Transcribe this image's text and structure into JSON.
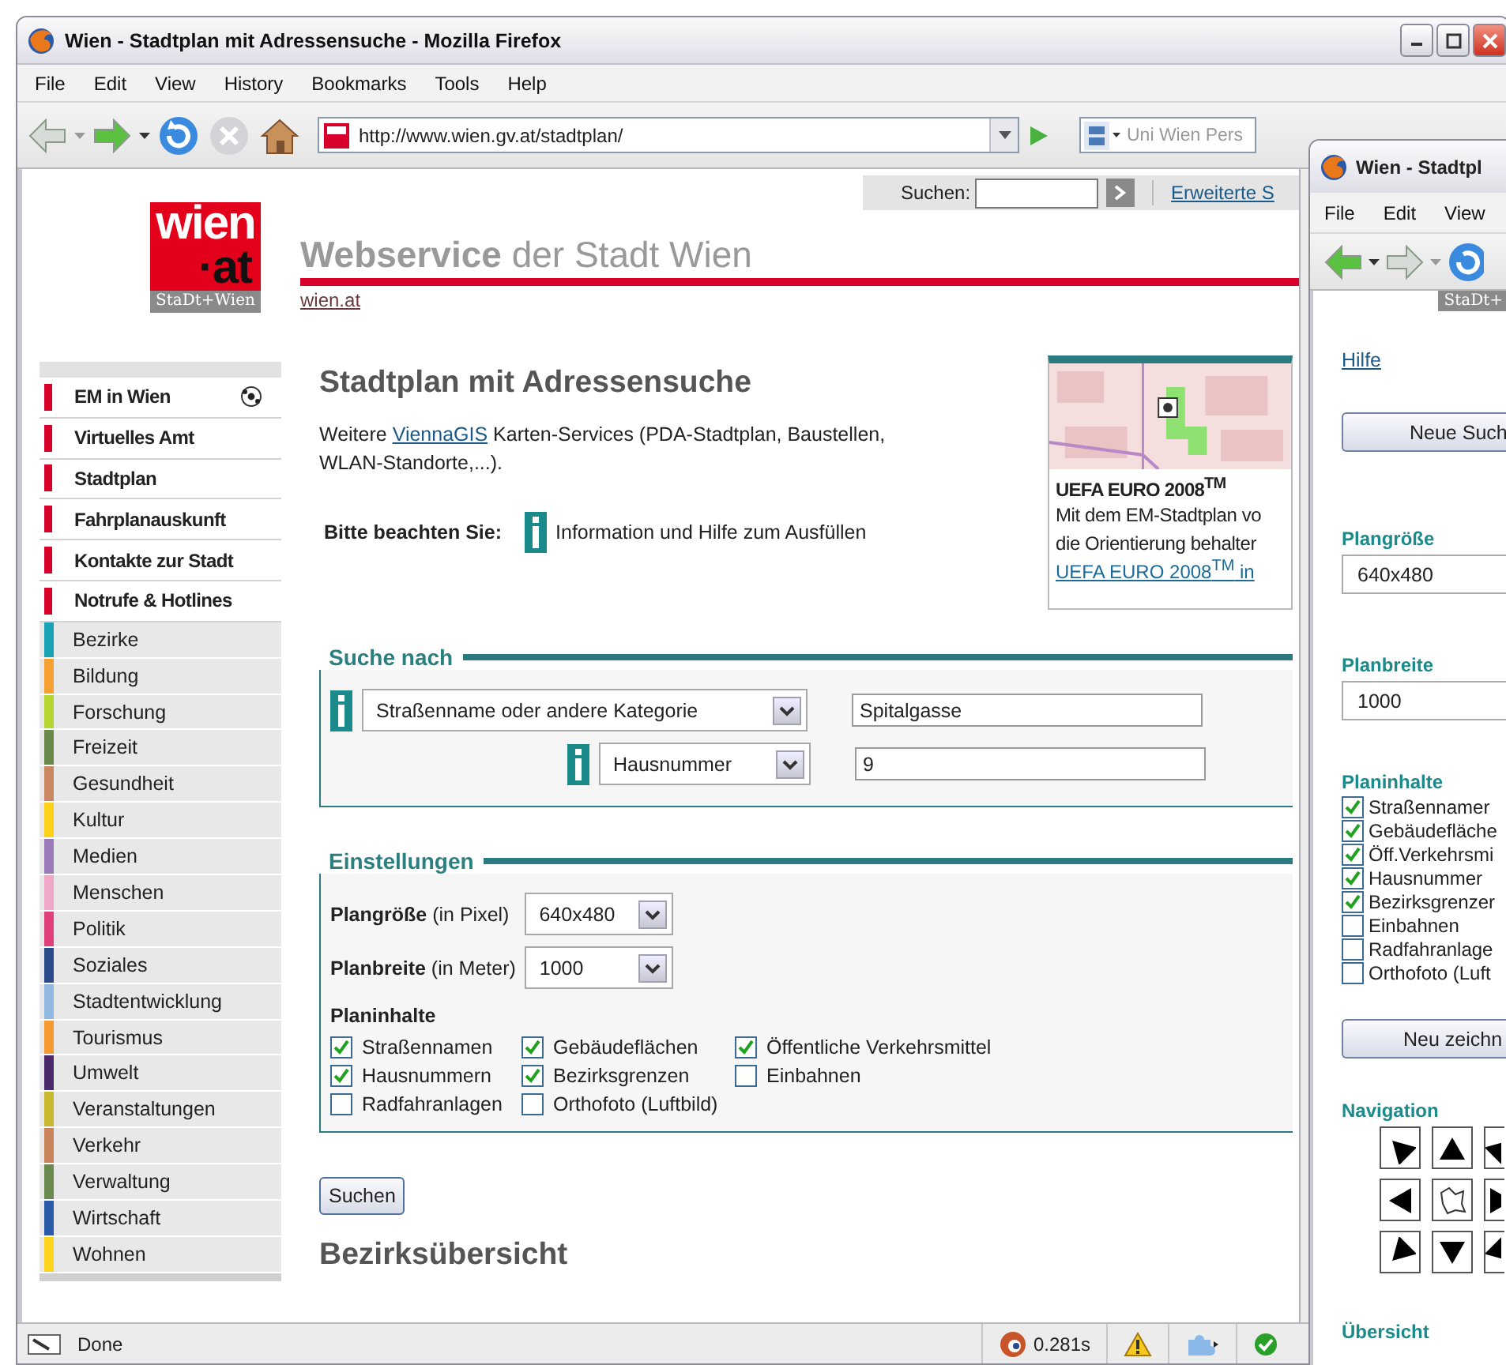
{
  "window": {
    "title": "Wien - Stadtplan mit Adressensuche - Mozilla Firefox"
  },
  "menu": [
    "File",
    "Edit",
    "View",
    "History",
    "Bookmarks",
    "Tools",
    "Help"
  ],
  "toolbar": {
    "url": "http://www.wien.gv.at/stadtplan/",
    "search_placeholder": "Uni Wien Pers"
  },
  "page": {
    "top_search": {
      "label": "Suchen:",
      "advanced_link": "Erweiterte S"
    },
    "logo": {
      "top": "wien",
      "middle": "·at",
      "bottom": "StaDt+Wien"
    },
    "site_title": "**Webservice** der Stadt Wien",
    "site_link": "wien.at",
    "sidebar": {
      "primary": [
        {
          "label": "EM in Wien",
          "ball_icon": true
        },
        {
          "label": "Virtuelles Amt",
          "ball_icon": false
        },
        {
          "label": "Stadtplan",
          "ball_icon": false
        },
        {
          "label": "Fahrplanauskunft",
          "ball_icon": false
        },
        {
          "label": "Kontakte zur Stadt",
          "ball_icon": false
        },
        {
          "label": "Notrufe & Hotlines",
          "ball_icon": false
        }
      ],
      "categories": [
        {
          "label": "Bezirke",
          "color": "#1aa3b5"
        },
        {
          "label": "Bildung",
          "color": "#f5a030"
        },
        {
          "label": "Forschung",
          "color": "#b5d531"
        },
        {
          "label": "Freizeit",
          "color": "#6a8a4a"
        },
        {
          "label": "Gesundheit",
          "color": "#c98860"
        },
        {
          "label": "Kultur",
          "color": "#ffd21a"
        },
        {
          "label": "Medien",
          "color": "#9a7ab8"
        },
        {
          "label": "Menschen",
          "color": "#f0a8c8"
        },
        {
          "label": "Politik",
          "color": "#e0407a"
        },
        {
          "label": "Soziales",
          "color": "#2a4a8a"
        },
        {
          "label": "Stadtentwicklung",
          "color": "#90b8e0"
        },
        {
          "label": "Tourismus",
          "color": "#f59a30"
        },
        {
          "label": "Umwelt",
          "color": "#4a2a6a"
        },
        {
          "label": "Veranstaltungen",
          "color": "#c8b830"
        },
        {
          "label": "Verkehr",
          "color": "#c9845c"
        },
        {
          "label": "Verwaltung",
          "color": "#6a8a50"
        },
        {
          "label": "Wirtschaft",
          "color": "#2a5aa8"
        },
        {
          "label": "Wohnen",
          "color": "#ffd41c"
        }
      ]
    },
    "heading": "Stadtplan mit Adressensuche",
    "intro": {
      "before": "Weitere ",
      "link": "ViennaGIS",
      "after": " Karten-Services (PDA-Stadtplan, Baustellen, WLAN-Standorte,...)."
    },
    "notice": {
      "label": "Bitte beachten Sie:",
      "text": "Information und Hilfe zum Ausfüllen"
    },
    "promo": {
      "title": "UEFA EURO 2008$^{TM}$",
      "lines": [
        "Mit dem EM-Stadtplan vo",
        "die Orientierung behalter"
      ],
      "link": "UEFA EURO 2008$^{TM}$ in"
    },
    "search_section": {
      "legend": "Suche nach",
      "rows": [
        {
          "category": "Straßenname oder andere Kategorie",
          "value": "Spitalgasse"
        },
        {
          "category": "Hausnummer",
          "value": "9"
        }
      ]
    },
    "settings": {
      "legend": "Einstellungen",
      "size": {
        "label": "**Plangröße** (in Pixel)",
        "value": "640x480"
      },
      "width": {
        "label": "**Planbreite** (in Meter)",
        "value": "1000"
      },
      "contents_label": "Planinhalte",
      "layers": [
        {
          "label": "Straßennamen",
          "checked": true
        },
        {
          "label": "Gebäudeflächen",
          "checked": true
        },
        {
          "label": "Öffentliche Verkehrsmittel",
          "checked": true
        },
        {
          "label": "Hausnummern",
          "checked": true
        },
        {
          "label": "Bezirksgrenzen",
          "checked": true
        },
        {
          "label": "Einbahnen",
          "checked": false
        },
        {
          "label": "Radfahranlagen",
          "checked": false
        },
        {
          "label": "Orthofoto (Luftbild)",
          "checked": false
        }
      ]
    },
    "submit": "Suchen",
    "overview_heading": "Bezirksübersicht"
  },
  "status_bar": {
    "text": "Done",
    "timing": "0.281s"
  },
  "popup_window": {
    "title": "Wien - Stadtpl",
    "menu": [
      "File",
      "Edit",
      "View"
    ],
    "logo_strip": "StaDt+",
    "help_link": "Hilfe",
    "new_search": "Neue Such",
    "size_label": "Plangröße",
    "size_value": "640x480",
    "width_label": "Planbreite",
    "width_value": "1000",
    "contents_label": "Planinhalte",
    "layers": [
      {
        "label": "Straßennamer",
        "checked": true
      },
      {
        "label": "Gebäudefläche",
        "checked": true
      },
      {
        "label": "Öff.Verkehrsmi",
        "checked": true
      },
      {
        "label": "Hausnummer",
        "checked": true
      },
      {
        "label": "Bezirksgrenzer",
        "checked": true
      },
      {
        "label": "Einbahnen",
        "checked": false
      },
      {
        "label": "Radfahranlage",
        "checked": false
      },
      {
        "label": "Orthofoto (Luft",
        "checked": false
      }
    ],
    "redraw": "Neu zeichn",
    "navigation_label": "Navigation",
    "overview_label": "Übersicht"
  }
}
